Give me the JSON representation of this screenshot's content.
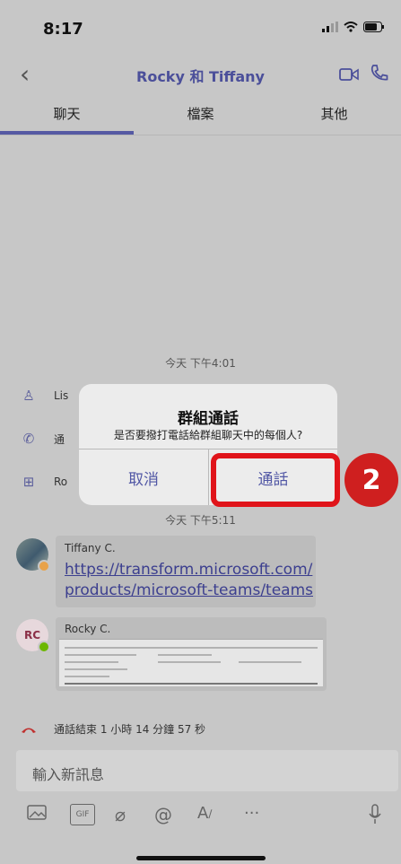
{
  "status": {
    "time": "8:17"
  },
  "header": {
    "title": "Rocky 和 Tiffany"
  },
  "tabs": [
    {
      "label": "聊天",
      "active": true
    },
    {
      "label": "檔案",
      "active": false
    },
    {
      "label": "其他",
      "active": false
    }
  ],
  "chat": {
    "timestamp1": "今天 下午4:01",
    "sys1_text": "Lis",
    "sys2_text": "通",
    "sys3_text": "Ro",
    "timestamp2": "今天 下午5:11",
    "msg1": {
      "sender": "Tiffany C.",
      "link_line1": "https://transform.microsoft.com/",
      "link_line2": "products/microsoft-teams/teams"
    },
    "msg2": {
      "sender": "Rocky C.",
      "avatar_initials": "RC"
    },
    "call_ended": "通話結束 1 小時 14 分鐘 57 秒"
  },
  "composer": {
    "placeholder": "輸入新訊息"
  },
  "dialog": {
    "title": "群組通話",
    "message": "是否要撥打電話給群組聊天中的每個人?",
    "cancel_label": "取消",
    "call_label": "通話"
  },
  "annotation": {
    "step_number": "2",
    "color": "#d0141a"
  },
  "colors": {
    "brand": "#4b4f9a",
    "call_end": "#c0312f",
    "presence": "#6bb700"
  }
}
